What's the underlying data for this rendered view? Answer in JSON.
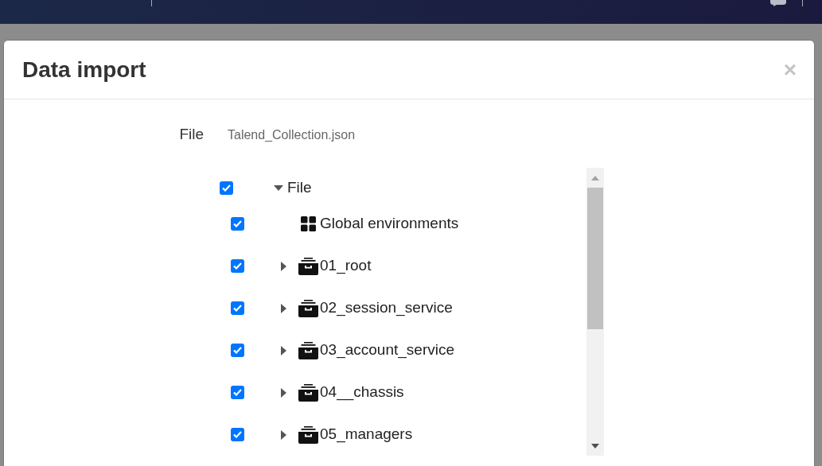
{
  "dialog": {
    "title": "Data import",
    "close": "×",
    "file_label": "File",
    "file_name": "Talend_Collection.json"
  },
  "tree": [
    {
      "label": "File",
      "checked": true,
      "expanded": true,
      "children": [
        {
          "kind": "environments",
          "label": "Global environments",
          "checked": true
        },
        {
          "kind": "folder",
          "label": "01_root",
          "checked": true,
          "expanded": false
        },
        {
          "kind": "folder",
          "label": "02_session_service",
          "checked": true,
          "expanded": false
        },
        {
          "kind": "folder",
          "label": "03_account_service",
          "checked": true,
          "expanded": false
        },
        {
          "kind": "folder",
          "label": "04__chassis",
          "checked": true,
          "expanded": false
        },
        {
          "kind": "folder",
          "label": "05_managers",
          "checked": true,
          "expanded": false
        }
      ]
    }
  ]
}
